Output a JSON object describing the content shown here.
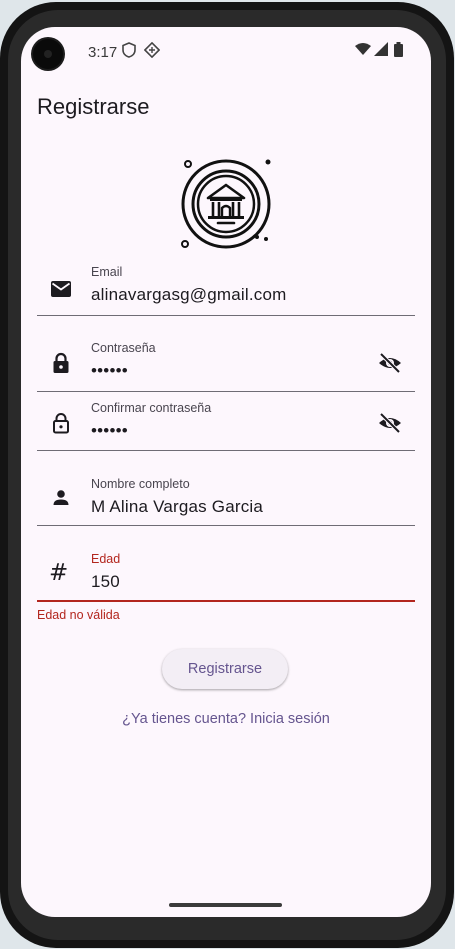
{
  "status_bar": {
    "time": "3:17",
    "left_icons": [
      "shield-icon",
      "data-saver-icon"
    ],
    "right_icons": [
      "wifi-icon",
      "cellular-icon",
      "battery-icon"
    ]
  },
  "app_bar": {
    "title": "Registrarse"
  },
  "logo": {
    "icon": "bank-building-icon"
  },
  "form": {
    "email": {
      "label": "Email",
      "value": "alinavargasg@gmail.com",
      "icon": "mail-icon"
    },
    "password": {
      "label": "Contraseña",
      "value": "••••••",
      "icon": "lock-icon",
      "toggle_icon": "visibility-off-icon"
    },
    "confirm_password": {
      "label": "Confirmar contraseña",
      "value": "••••••",
      "icon": "lock-outline-icon",
      "toggle_icon": "visibility-off-icon"
    },
    "full_name": {
      "label": "Nombre completo",
      "value": "M Alina Vargas Garcia",
      "icon": "person-icon"
    },
    "age": {
      "label": "Edad",
      "value": "150",
      "icon": "hash-icon",
      "error": "Edad no válida"
    }
  },
  "actions": {
    "register_button": "Registrarse",
    "login_link": "¿Ya tienes cuenta? Inicia sesión"
  },
  "colors": {
    "background": "#fdf7fd",
    "primary": "#65558f",
    "error": "#b3261e",
    "text": "#1d1b20"
  }
}
